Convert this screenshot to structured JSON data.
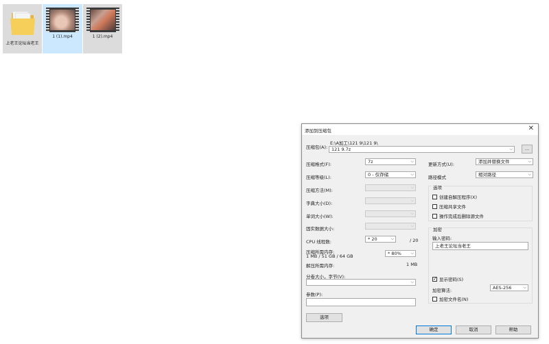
{
  "explorer": {
    "items": [
      {
        "name": "上老王论坛当老王",
        "type": "folder"
      },
      {
        "name": "1 (1).mp4",
        "type": "video"
      },
      {
        "name": "1 (2).mp4",
        "type": "video"
      }
    ]
  },
  "dialog": {
    "title": "添加到压缩包",
    "close_glyph": "✕",
    "archive": {
      "label": "压缩包(A):",
      "path": "E:\\A加工\\121 9\\121 9\\",
      "value": "121 9.7z",
      "browse_label": "..."
    },
    "left": {
      "format": {
        "label": "压缩格式(F):",
        "value": "7z"
      },
      "level": {
        "label": "压缩等级(L):",
        "value": "0 - 仅存储"
      },
      "method": {
        "label": "压缩方法(M):",
        "value": ""
      },
      "dict": {
        "label": "字典大小(D):",
        "value": ""
      },
      "word": {
        "label": "单词大小(W):",
        "value": ""
      },
      "solid": {
        "label": "固实数据大小:",
        "value": ""
      },
      "threads": {
        "label": "CPU 线程数:",
        "value": "* 20",
        "max": "/ 20"
      },
      "mem_compress": {
        "label": "压缩所需内存:",
        "detail": "1 MB / 51 GB / 64 GB",
        "percent": "* 80%"
      },
      "mem_decompress": {
        "label": "解压所需内存:",
        "value": "1 MB"
      },
      "volume": {
        "label": "分卷大小，字节(V):",
        "value": ""
      },
      "params": {
        "label": "参数(P):",
        "value": ""
      },
      "options_button": "选项"
    },
    "right": {
      "update": {
        "label": "更新方式(U):",
        "value": "添加并替换文件"
      },
      "path_mode": {
        "label": "路径模式",
        "value": "相对路径"
      },
      "options_group": {
        "title": "选项",
        "checkboxes": [
          {
            "label": "创建自解压程序(X)",
            "checked": false
          },
          {
            "label": "压缩共享文件",
            "checked": false
          },
          {
            "label": "操作完成后删除源文件",
            "checked": false
          }
        ]
      },
      "encryption_group": {
        "title": "加密",
        "password_label": "输入密码:",
        "password_value": "上老王论坛当老王",
        "show_password": {
          "label": "显示密码(S)",
          "checked": true
        },
        "method_label": "加密算法:",
        "method_value": "AES-256",
        "encrypt_names": {
          "label": "加密文件名(N)",
          "checked": false
        }
      }
    },
    "buttons": {
      "ok": "确定",
      "cancel": "取消",
      "help": "帮助"
    }
  },
  "colors": {
    "selection": "#cce8ff",
    "dialog_bg": "#f0f0f0",
    "focus_border": "#0078d7"
  }
}
